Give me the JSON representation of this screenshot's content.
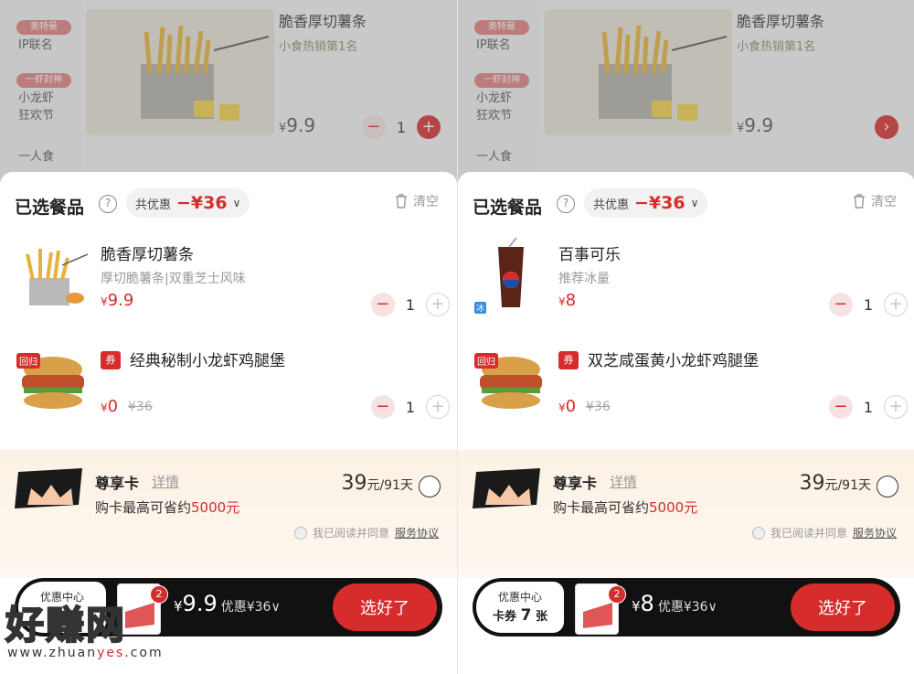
{
  "colors": {
    "accent": "#d62c2c",
    "dark_bar": "#111111",
    "card_bg": "#fbf1e4"
  },
  "panels": [
    {
      "menu": {
        "tag1": "奥特曼",
        "cat1": "IP联名",
        "tag2": "一虾封神",
        "cat2a": "小龙虾",
        "cat2b": "狂欢节",
        "cat3": "一人食",
        "product_name": "脆香厚切薯条",
        "product_sub": "小食热销第1名",
        "price_prefix": "¥",
        "price": "9.9",
        "qty": "1"
      },
      "sheet": {
        "title": "已选餐品",
        "help": "?",
        "discount_label": "共优惠",
        "discount_value": "−¥36",
        "clear_label": "清空",
        "items": [
          {
            "name": "脆香厚切薯条",
            "desc": "厚切脆薯条|双重芝士风味",
            "price_prefix": "¥",
            "price": "9.9",
            "orig": "",
            "qty": "1"
          },
          {
            "coupon": "券",
            "ret": "回归",
            "name": "经典秘制小龙虾鸡腿堡",
            "price_prefix": "¥",
            "price": "0",
            "orig": "¥36",
            "qty": "1"
          }
        ],
        "card": {
          "title": "尊享卡",
          "detail": "详情",
          "save_prefix": "购卡最高可省约",
          "save_value": "5000元",
          "price": "39",
          "price_unit": "元/91天",
          "agree_text": "我已阅读并同意",
          "agree_link": "服务协议"
        },
        "bottom": {
          "cc_line1": "优惠中心",
          "cc_line2_prefix": "卡券",
          "cc_count": "",
          "cc_suffix": "",
          "badge": "2",
          "total_prefix": "¥",
          "total": "9.9",
          "total_discount": "优惠¥36∨",
          "submit": "选好了"
        }
      }
    },
    {
      "menu": {
        "tag1": "奥特曼",
        "cat1": "IP联名",
        "tag2": "一虾封神",
        "cat2a": "小龙虾",
        "cat2b": "狂欢节",
        "cat3": "一人食",
        "product_name": "脆香厚切薯条",
        "product_sub": "小食热销第1名",
        "price_prefix": "¥",
        "price": "9.9"
      },
      "sheet": {
        "title": "已选餐品",
        "help": "?",
        "discount_label": "共优惠",
        "discount_value": "−¥36",
        "clear_label": "清空",
        "items": [
          {
            "name": "百事可乐",
            "desc": "推荐冰量",
            "price_prefix": "¥",
            "price": "8",
            "orig": "",
            "qty": "1",
            "ice": "冰"
          },
          {
            "coupon": "券",
            "ret": "回归",
            "name": "双芝咸蛋黄小龙虾鸡腿堡",
            "price_prefix": "¥",
            "price": "0",
            "orig": "¥36",
            "qty": "1"
          }
        ],
        "card": {
          "title": "尊享卡",
          "detail": "详情",
          "save_prefix": "购卡最高可省约",
          "save_value": "5000元",
          "price": "39",
          "price_unit": "元/91天",
          "agree_text": "我已阅读并同意",
          "agree_link": "服务协议"
        },
        "bottom": {
          "cc_line1": "优惠中心",
          "cc_line2_prefix": "卡券",
          "cc_count": "7",
          "cc_suffix": "张",
          "badge": "2",
          "total_prefix": "¥",
          "total": "8",
          "total_discount": "优惠¥36∨",
          "submit": "选好了"
        }
      }
    }
  ],
  "watermark": {
    "main": "好赚网",
    "url_pre": "www.zhuan",
    "url_mid": "yes",
    "url_post": ".com"
  }
}
